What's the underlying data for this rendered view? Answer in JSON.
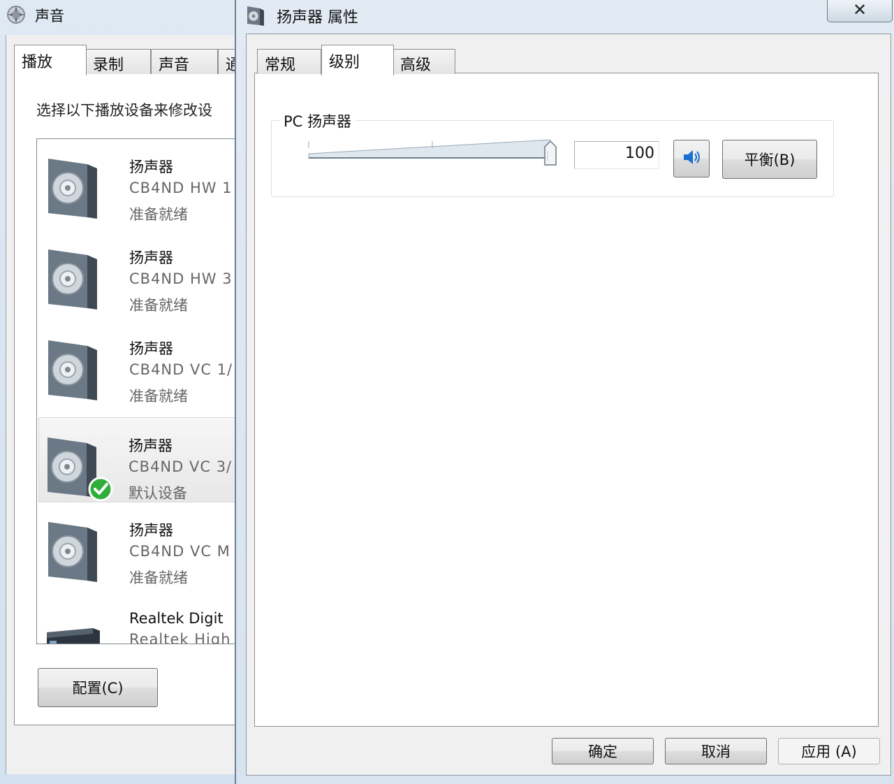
{
  "sound_window": {
    "title": "声音",
    "tabs": [
      {
        "label": "播放",
        "selected": true
      },
      {
        "label": "录制",
        "selected": false
      },
      {
        "label": "声音",
        "selected": false
      },
      {
        "label": "通",
        "selected": false
      }
    ],
    "hint": "选择以下播放设备来修改设",
    "devices": [
      {
        "name": "扬声器",
        "detail": "CB4ND HW 1",
        "status": "准备就绪",
        "default": false
      },
      {
        "name": "扬声器",
        "detail": "CB4ND HW 3",
        "status": "准备就绪",
        "default": false
      },
      {
        "name": "扬声器",
        "detail": "CB4ND VC 1/",
        "status": "准备就绪",
        "default": false
      },
      {
        "name": "扬声器",
        "detail": "CB4ND VC 3/",
        "status": "默认设备",
        "default": true
      },
      {
        "name": "扬声器",
        "detail": "CB4ND VC M",
        "status": "准备就绪",
        "default": false
      },
      {
        "name": "Realtek Digit",
        "detail": "Realtek High",
        "status": "",
        "default": false
      }
    ],
    "configure_label": "配置(C)"
  },
  "props_window": {
    "title": "扬声器 属性",
    "close_glyph": "✕",
    "tabs": [
      {
        "label": "常规",
        "selected": false
      },
      {
        "label": "级别",
        "selected": true
      },
      {
        "label": "高级",
        "selected": false
      }
    ],
    "levels": {
      "group_label": "PC 扬声器",
      "volume_value": "100",
      "volume_fraction": 1.0,
      "balance_label": "平衡(B)"
    },
    "buttons": {
      "ok": "确定",
      "cancel": "取消",
      "apply": "应用 (A)"
    }
  },
  "colors": {
    "accent": "#1a6fd1",
    "check_green": "#2fae3a",
    "panel_border": "#8e8f8f"
  }
}
